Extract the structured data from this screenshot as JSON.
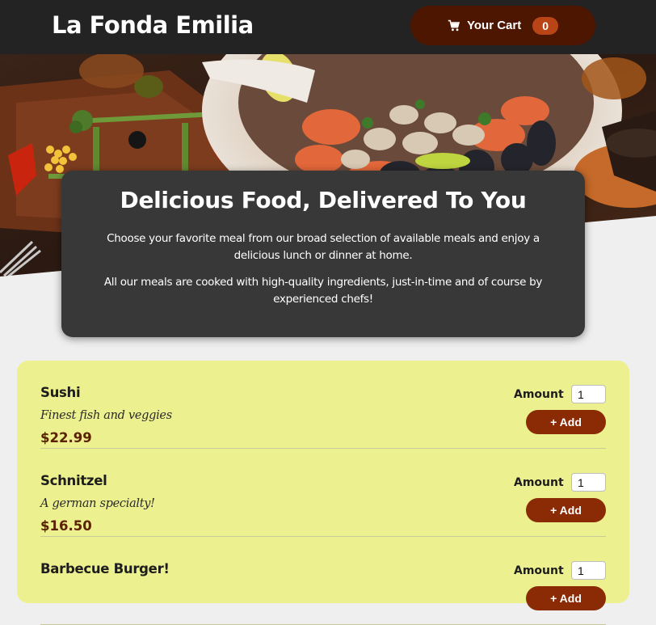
{
  "header": {
    "title": "La Fonda Emilia",
    "cart": {
      "label": "Your Cart",
      "count": "0"
    }
  },
  "summary": {
    "heading": "Delicious Food, Delivered To You",
    "paragraph1": "Choose your favorite meal from our broad selection of available meals and enjoy a delicious lunch or dinner at home.",
    "paragraph2": "All our meals are cooked with high-quality ingredients, just-in-time and of course by experienced chefs!"
  },
  "meals": [
    {
      "name": "Sushi",
      "description": "Finest fish and veggies",
      "price": "$22.99",
      "amount_label": "Amount",
      "amount": "1",
      "add_label": "+ Add"
    },
    {
      "name": "Schnitzel",
      "description": "A german specialty!",
      "price": "$16.50",
      "amount_label": "Amount",
      "amount": "1",
      "add_label": "+ Add"
    },
    {
      "name": "Barbecue Burger!",
      "description": "",
      "price": "",
      "amount_label": "Amount",
      "amount": "1",
      "add_label": "+ Add"
    }
  ],
  "colors": {
    "header_bg": "#232323",
    "cart_button": "#4d1601",
    "cart_badge": "#b94517",
    "meals_bg": "#edf08f",
    "add_button": "#8a2b06",
    "price": "#5a2200"
  },
  "icons": {
    "cart": "shopping-cart-icon"
  }
}
